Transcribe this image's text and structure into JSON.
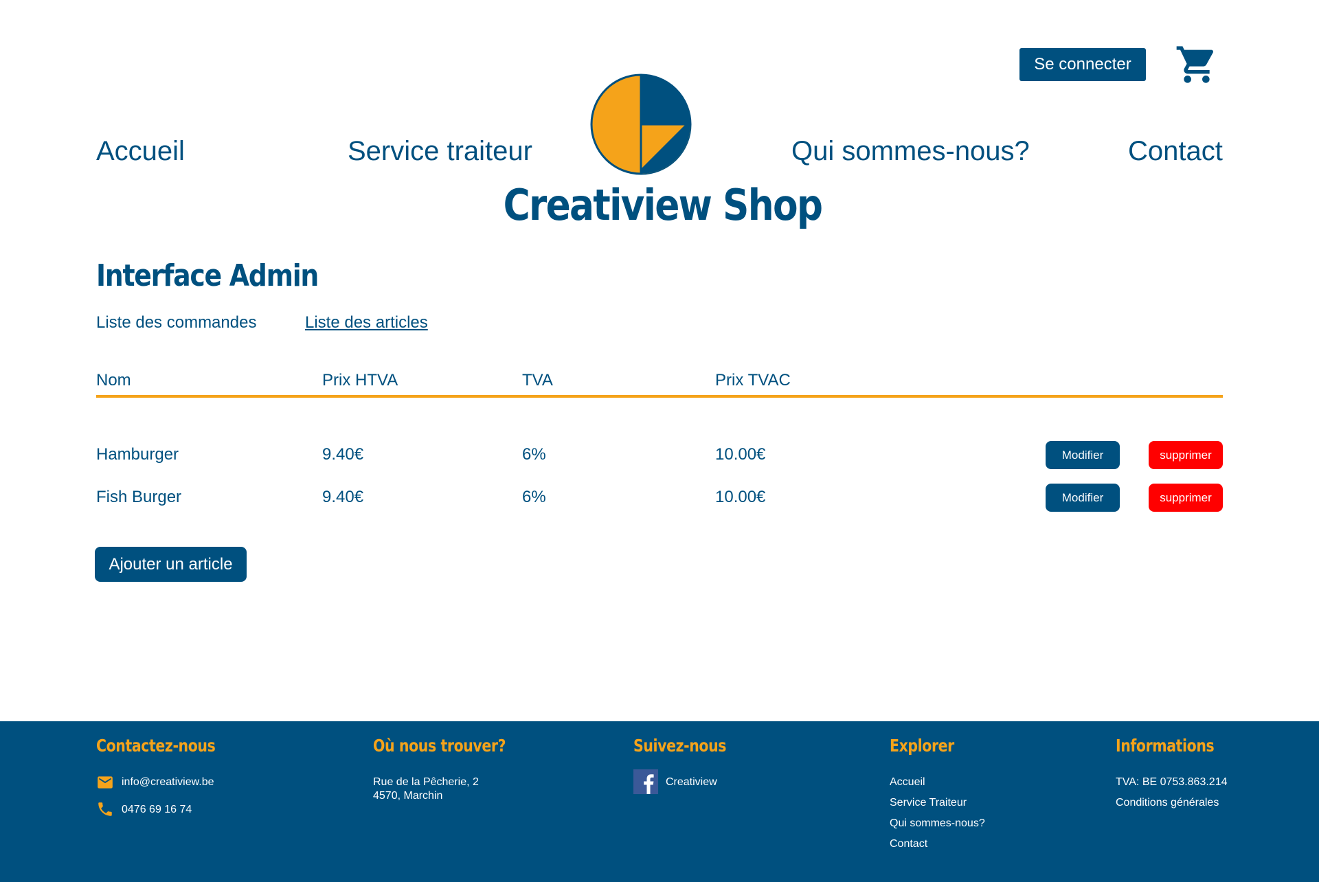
{
  "header": {
    "login_label": "Se connecter",
    "cart_icon": "cart-icon",
    "nav": {
      "home": "Accueil",
      "catering": "Service traiteur",
      "about": "Qui sommes-nous?",
      "contact": "Contact"
    },
    "brand": "Creatiview Shop"
  },
  "admin": {
    "title": "Interface Admin",
    "tabs": {
      "orders": "Liste des commandes",
      "articles": "Liste des articles"
    },
    "active_tab": "articles",
    "columns": {
      "name": "Nom",
      "price_excl": "Prix HTVA",
      "vat": "TVA",
      "price_incl": "Prix TVAC"
    },
    "rows": [
      {
        "name": "Hamburger",
        "price_excl": "9.40€",
        "vat": "6%",
        "price_incl": "10.00€",
        "modify": "Modifier",
        "delete": "supprimer"
      },
      {
        "name": "Fish Burger",
        "price_excl": "9.40€",
        "vat": "6%",
        "price_incl": "10.00€",
        "modify": "Modifier",
        "delete": "supprimer"
      }
    ],
    "add_label": "Ajouter un article"
  },
  "footer": {
    "contact": {
      "heading": "Contactez-nous",
      "email": "info@creatiview.be",
      "phone": "0476 69 16 74"
    },
    "location": {
      "heading": "Où nous trouver?",
      "line1": "Rue de la Pêcherie, 2",
      "line2": "4570, Marchin"
    },
    "social": {
      "heading": "Suivez-nous",
      "facebook": "Creatiview"
    },
    "explore": {
      "heading": "Explorer",
      "links": [
        "Accueil",
        "Service Traiteur",
        "Qui sommes-nous?",
        "Contact"
      ]
    },
    "info": {
      "heading": "Informations",
      "vat": "TVA: BE 0753.863.214",
      "terms": "Conditions générales"
    }
  },
  "colors": {
    "primary": "#00507f",
    "accent": "#f5a31a",
    "danger": "#ff0000",
    "background": "#ffffff"
  }
}
